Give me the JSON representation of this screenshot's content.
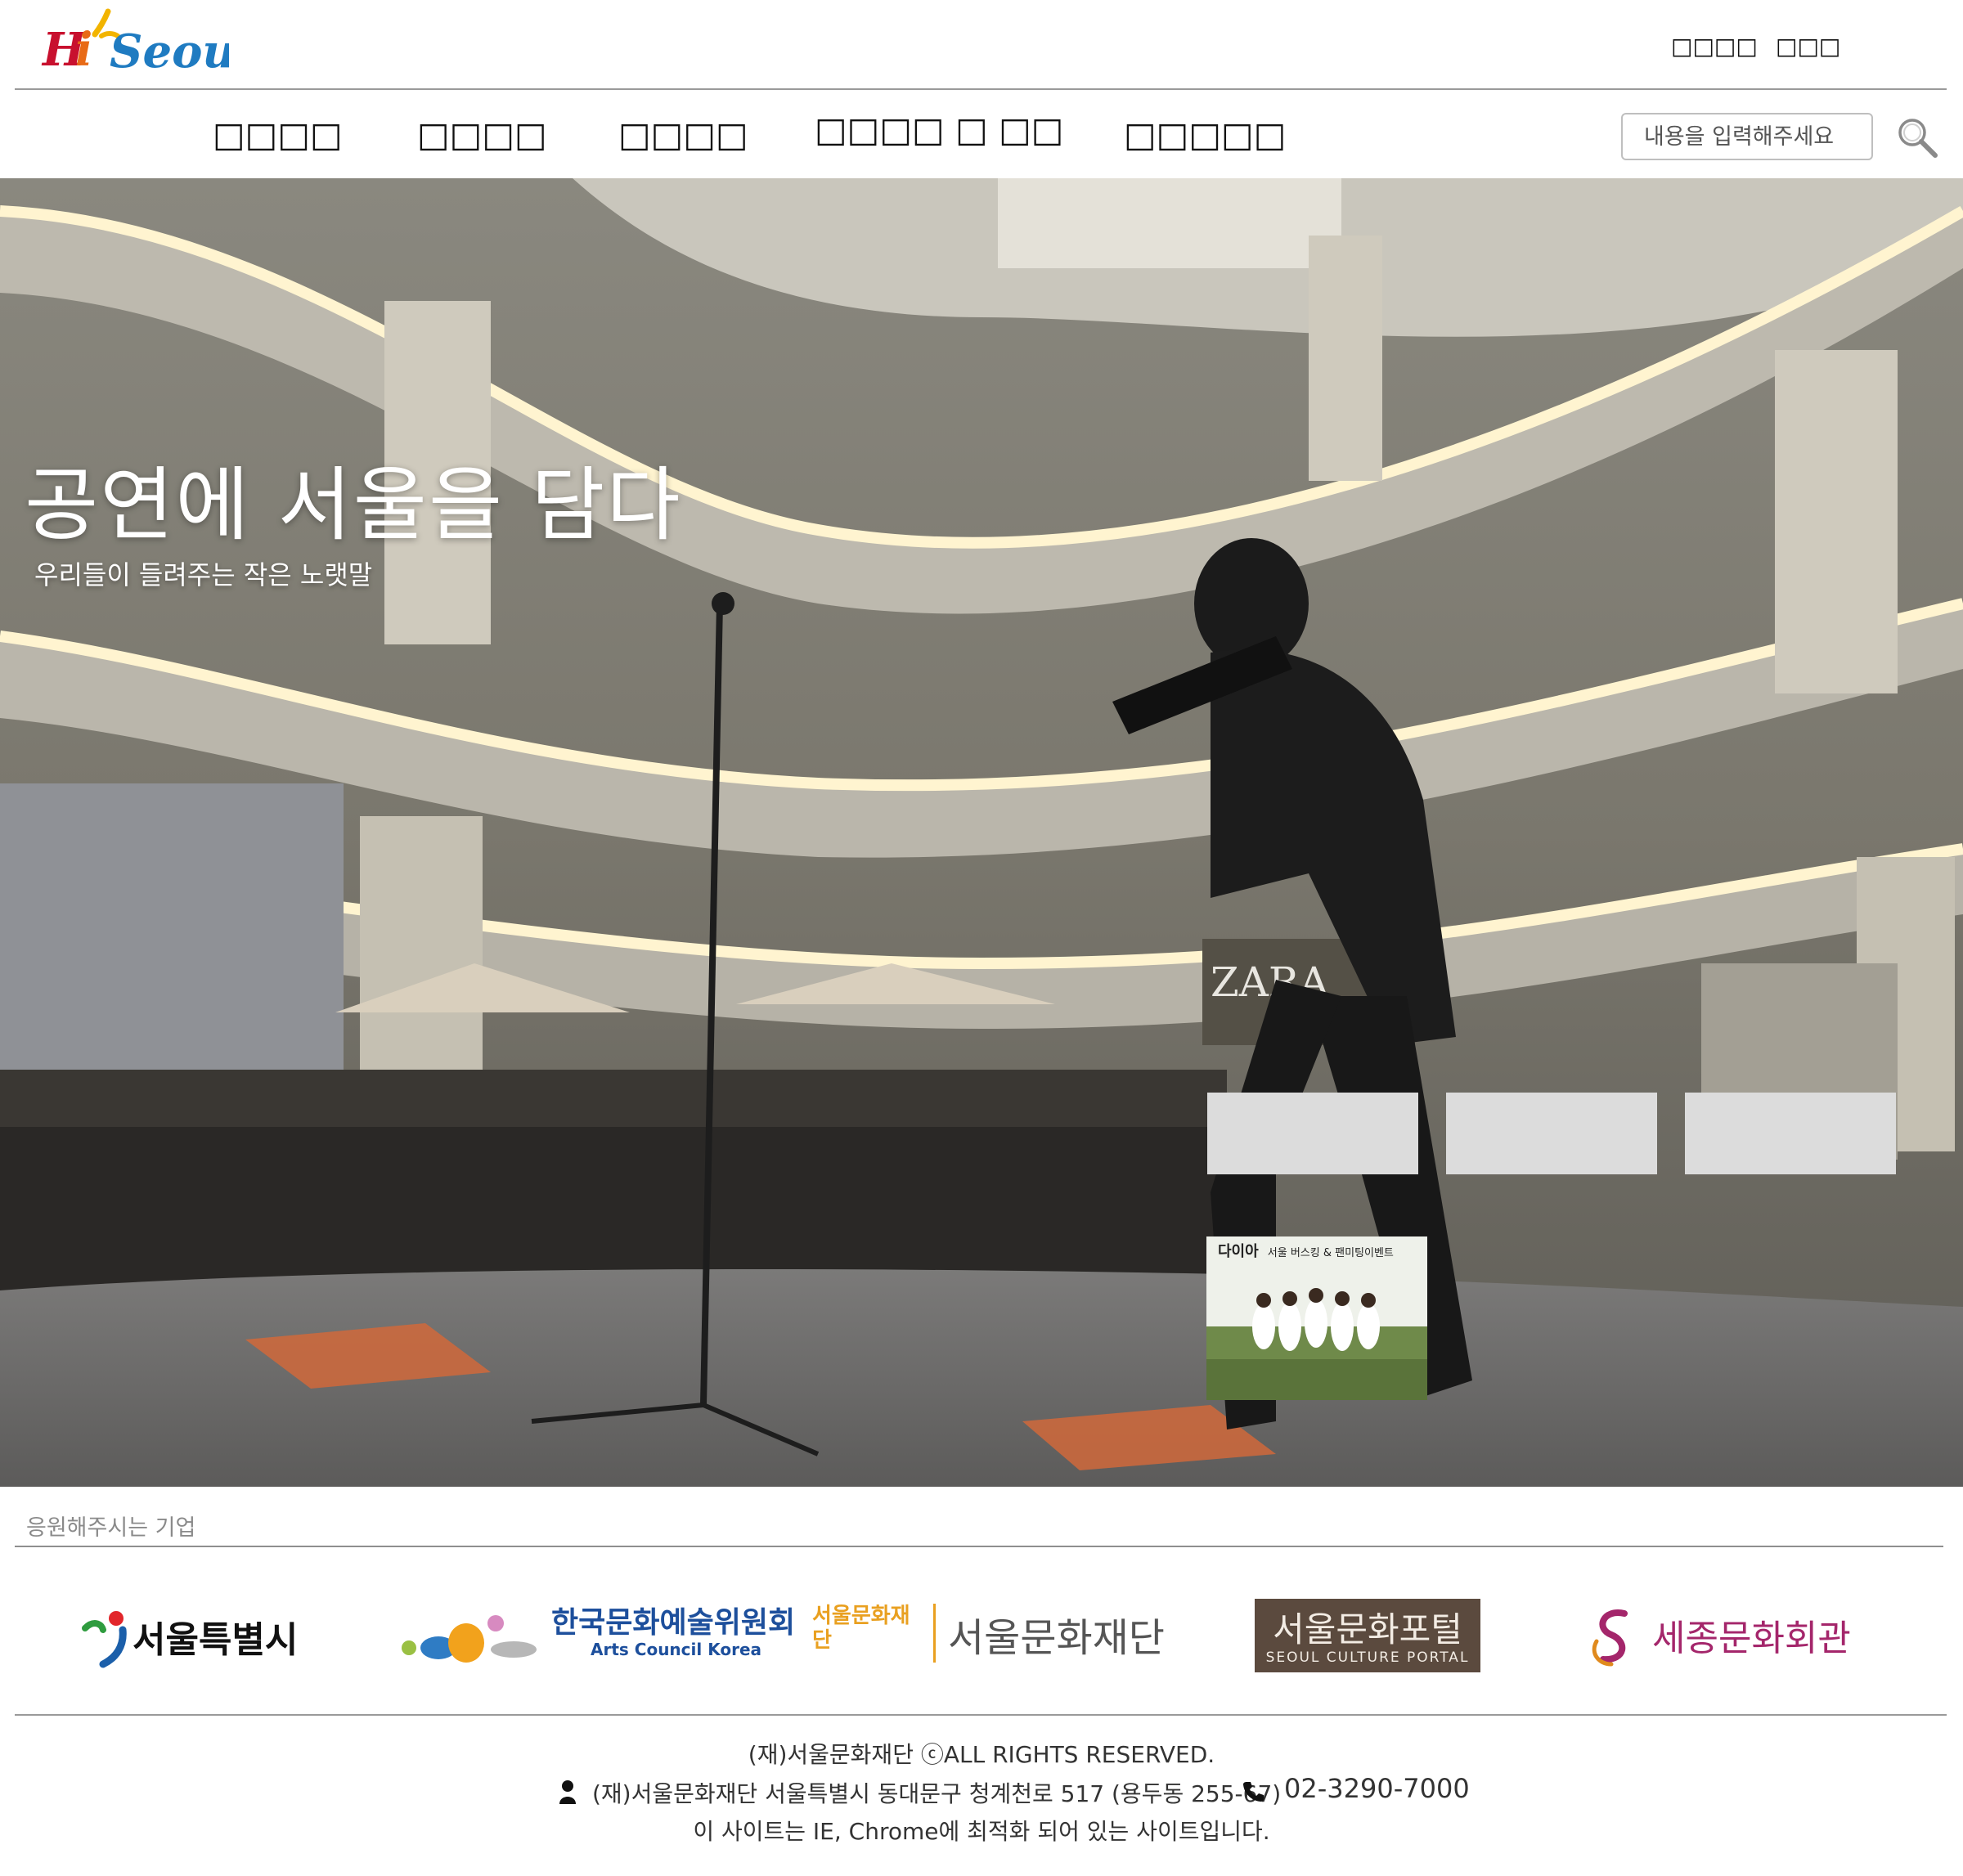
{
  "header": {
    "logo_text": "Hi Seoul",
    "links": [
      "□□□□",
      "□□□"
    ]
  },
  "nav": {
    "items": [
      "□□□□",
      "□□□□",
      "□□□□",
      "□□□□ □ □□",
      "□□□□□"
    ],
    "search_placeholder": "내용을 입력해주세요",
    "search_icon": "search-icon"
  },
  "hero": {
    "title": "공연에 서울을 담다",
    "subtitle": "우리들이 들려주는 작은 노랫말",
    "tiles": [
      "",
      "",
      ""
    ],
    "poster": {
      "title": "다이아",
      "subtitle": "서울 버스킹 & 팬미팅이벤트"
    }
  },
  "sponsors": {
    "label": "응원해주시는 기업",
    "logos": [
      {
        "name": "서울특별시"
      },
      {
        "name": "한국문화예술위원회",
        "sub": "Arts Council Korea"
      },
      {
        "name": "서울문화재단",
        "mark": "서울문화재단"
      },
      {
        "name": "서울문화포털",
        "sub": "SEOUL CULTURE PORTAL"
      },
      {
        "name": "세종문화회관"
      }
    ]
  },
  "footer": {
    "copyright": "(재)서울문화재단 ⓒALL RIGHTS RESERVED.",
    "address": "(재)서울문화재단 서울특별시 동대문구 청계천로 517 (용두동 255-67)",
    "phone": "02-3290-7000",
    "notice": "이 사이트는 IE, Chrome에 최적화 되어 있는 사이트입니다.",
    "address_icon": "person-icon",
    "phone_icon": "phone-icon"
  }
}
